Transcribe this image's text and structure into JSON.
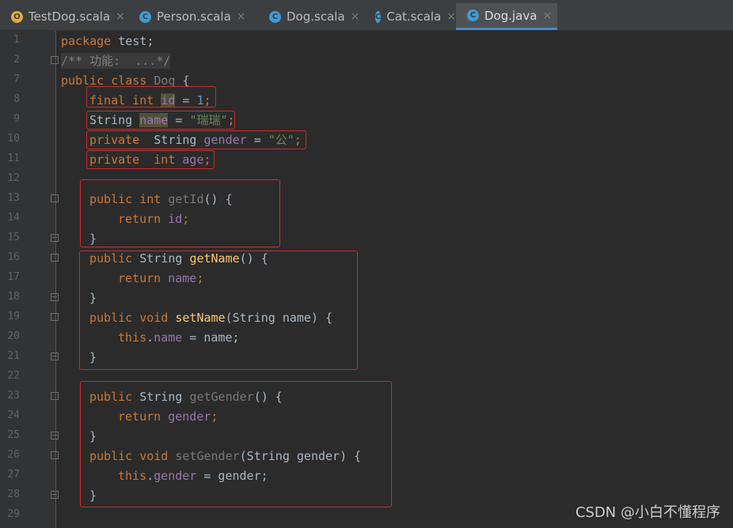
{
  "tabs": [
    {
      "label": "TestDog.scala",
      "icon": "scala-object-icon",
      "glyph": "O"
    },
    {
      "label": "Person.scala",
      "icon": "scala-class-icon",
      "glyph": "C"
    },
    {
      "label": "Dog.scala",
      "icon": "scala-class-icon",
      "glyph": "C"
    },
    {
      "label": "Cat.scala",
      "icon": "scala-class-icon",
      "glyph": "C"
    },
    {
      "label": "Dog.java",
      "icon": "java-class-icon",
      "glyph": "C",
      "active": true
    }
  ],
  "close_glyph": "×",
  "line_numbers": [
    "1",
    "2",
    "7",
    "8",
    "9",
    "10",
    "11",
    "12",
    "13",
    "14",
    "15",
    "16",
    "17",
    "18",
    "19",
    "20",
    "21",
    "22",
    "23",
    "24",
    "25",
    "26",
    "27",
    "28",
    "29"
  ],
  "code": {
    "l1": {
      "kw": "package",
      "rest": " test;"
    },
    "l2": {
      "text": "/** 功能:  ...*/"
    },
    "l7": {
      "kw": "public class",
      "name": "Dog",
      "rest": " {"
    },
    "l8": {
      "kw": "final int",
      "sp": " ",
      "field": "id",
      "rest": " = ",
      "num": "1",
      "end": ";"
    },
    "l9": {
      "type": "String",
      "sp": " ",
      "field": "name",
      "rest": " = ",
      "str": "\"瑞瑞\"",
      "end": ";"
    },
    "l10": {
      "kw": "private",
      "type": "  String ",
      "field": "gender",
      "rest": " = ",
      "str": "\"公\"",
      "end": ";"
    },
    "l11": {
      "kw": "private  int",
      "sp": " ",
      "field": "age",
      "end": ";"
    },
    "l13": {
      "kw": "public int",
      "sp": " ",
      "method": "getId",
      "rest": "() {"
    },
    "l14": {
      "kw": "return",
      "sp": " ",
      "field": "id",
      "end": ";"
    },
    "l15": {
      "text": "}"
    },
    "l16": {
      "kw": "public",
      "type": " String ",
      "method": "getName",
      "rest": "() {"
    },
    "l17": {
      "kw": "return",
      "sp": " ",
      "field": "name",
      "end": ";"
    },
    "l18": {
      "text": "}"
    },
    "l19": {
      "kw": "public void",
      "sp": " ",
      "method": "setName",
      "rest": "(String name) {"
    },
    "l20": {
      "kw": "this",
      "dot": ".",
      "field": "name",
      "rest": " = name;"
    },
    "l21": {
      "text": "}"
    },
    "l23": {
      "kw": "public",
      "type": " String ",
      "method": "getGender",
      "rest": "() {"
    },
    "l24": {
      "kw": "return",
      "sp": " ",
      "field": "gender",
      "end": ";"
    },
    "l25": {
      "text": "}"
    },
    "l26": {
      "kw": "public void",
      "sp": " ",
      "method": "setGender",
      "rest": "(String gender) {"
    },
    "l27": {
      "kw": "this",
      "dot": ".",
      "field": "gender",
      "rest": " = gender;"
    },
    "l28": {
      "text": "}"
    }
  },
  "watermark": "CSDN @小白不懂程序",
  "colors": {
    "keyword": "#cc7832",
    "string": "#6a8759",
    "field": "#9876aa",
    "method": "#ffc66d",
    "highlight_box": "#d02a2a",
    "accent": "#4a88c7"
  }
}
